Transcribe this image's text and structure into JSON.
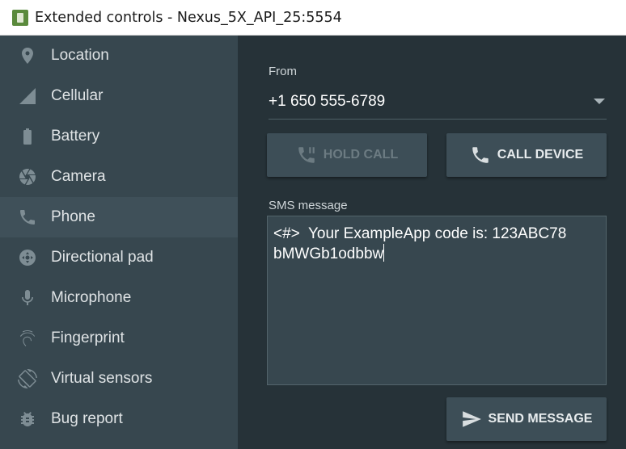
{
  "window": {
    "title": "Extended controls - Nexus_5X_API_25:5554",
    "icon": "android-emulator-icon"
  },
  "sidebar": {
    "items": [
      {
        "label": "Location",
        "icon": "location-pin-icon"
      },
      {
        "label": "Cellular",
        "icon": "cellular-signal-icon"
      },
      {
        "label": "Battery",
        "icon": "battery-icon"
      },
      {
        "label": "Camera",
        "icon": "camera-aperture-icon"
      },
      {
        "label": "Phone",
        "icon": "phone-icon",
        "active": true
      },
      {
        "label": "Directional pad",
        "icon": "dpad-icon"
      },
      {
        "label": "Microphone",
        "icon": "microphone-icon"
      },
      {
        "label": "Fingerprint",
        "icon": "fingerprint-icon"
      },
      {
        "label": "Virtual sensors",
        "icon": "rotation-icon"
      },
      {
        "label": "Bug report",
        "icon": "bug-icon"
      }
    ]
  },
  "phone": {
    "from_label": "From",
    "from_value": "+1 650 555-6789",
    "hold_call_label": "HOLD CALL",
    "call_device_label": "CALL DEVICE",
    "sms_label": "SMS message",
    "sms_text": "<#>  Your ExampleApp code is: 123ABC78\nbMWGb1odbbw",
    "send_message_label": "SEND MESSAGE"
  },
  "colors": {
    "sidebar_bg": "#37474f",
    "sidebar_active_bg": "#3f5059",
    "main_bg": "#263238",
    "button_bg": "#3d4e57"
  }
}
